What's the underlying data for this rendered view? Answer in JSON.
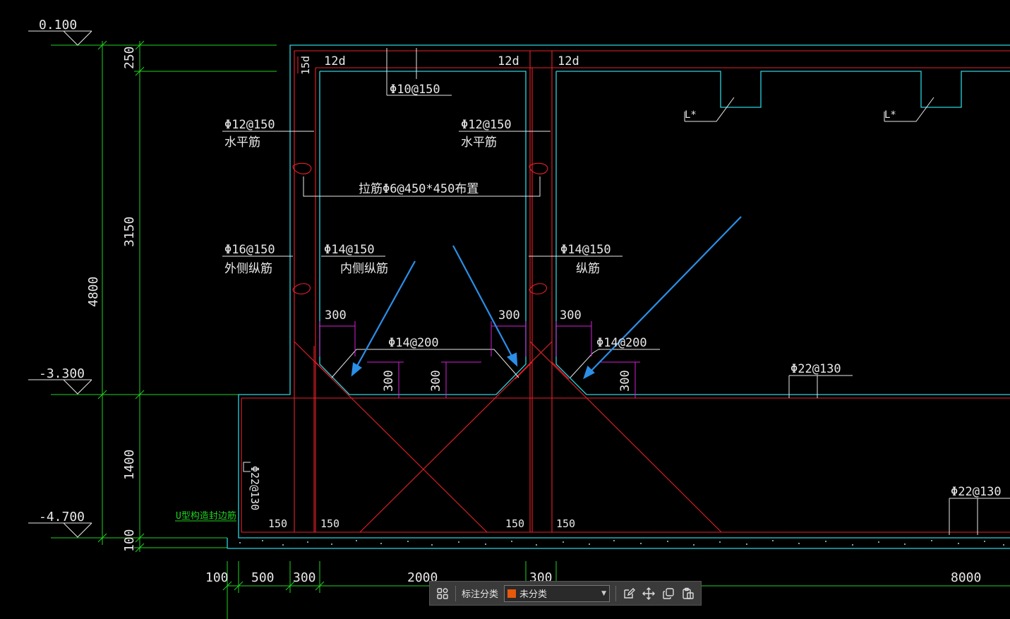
{
  "elevations": {
    "top": "0.100",
    "mid": "-3.300",
    "bottom": "-4.700"
  },
  "vertical_dims": {
    "d250": "250",
    "d3150": "3150",
    "d4800": "4800",
    "d1400": "1400",
    "d100": "100"
  },
  "horizontal_dims": {
    "d100": "100",
    "d500": "500",
    "d300a": "300",
    "d2000": "2000",
    "d300b": "300",
    "d8000": "8000"
  },
  "annotations": {
    "lap_12d_a": "12d",
    "lap_12d_b": "12d",
    "lap_12d_c": "12d",
    "lap_15d": "15d",
    "top_bar": "Φ10@150",
    "horiz_left_spec": "Φ12@150",
    "horiz_left_name": "水平筋",
    "horiz_mid_spec": "Φ12@150",
    "horiz_mid_name": "水平筋",
    "tie_bar": "拉筋Φ6@450*450布置",
    "outer_long_spec": "Φ16@150",
    "outer_long_name": "外侧纵筋",
    "inner_long_spec": "Φ14@150",
    "inner_long_name": "内侧纵筋",
    "right_long_spec": "Φ14@150",
    "right_long_name": "纵筋",
    "haunch_a": "300",
    "haunch_b": "300",
    "haunch_c": "300",
    "haunch_d": "300",
    "haunch_e": "300",
    "haunch_f": "300",
    "bottom_bar_left": "Φ14@200",
    "bottom_bar_right": "Φ14@200",
    "slab_bar": "Φ22@130",
    "slab_bar_low": "Φ22@130",
    "side_bar": "Φ22@130",
    "u_bar": "U型构造封边筋",
    "cover_a": "150",
    "cover_b": "150",
    "cover_c": "150",
    "cover_d": "150",
    "l_mark_a": "L*",
    "l_mark_b": "L*"
  },
  "toolbar": {
    "grid_icon": "grid-icon",
    "category_label": "标注分类",
    "category_value": "未分类",
    "category_color": "#e8590c"
  },
  "colors": {
    "concrete": "#2ad4e0",
    "rebar": "#e8202a",
    "dimension": "#21d221",
    "magenta": "#d61fd6",
    "arrow": "#2b8fe8",
    "text": "#e8e8e8"
  }
}
